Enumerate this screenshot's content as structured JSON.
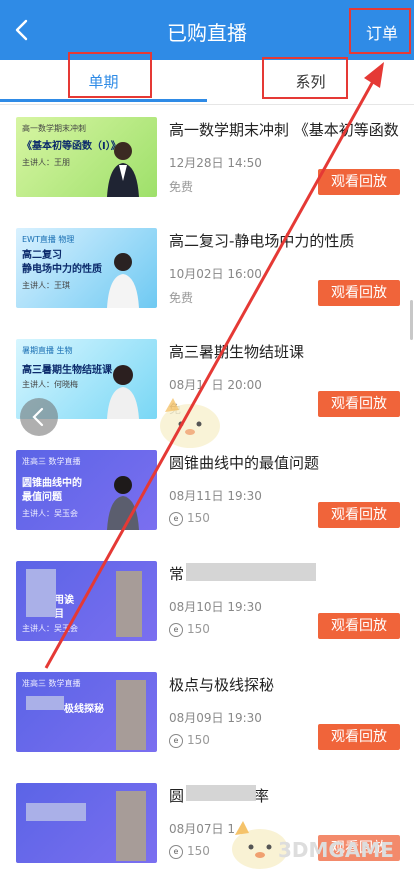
{
  "header": {
    "title": "已购直播",
    "order_label": "订单"
  },
  "tabs": [
    {
      "label": "单期",
      "active": true
    },
    {
      "label": "系列",
      "active": false
    }
  ],
  "items": [
    {
      "title": "高一数学期末冲刺 《基本初等函数",
      "time": "12月28日 14:50",
      "price": "免费",
      "action": "观看回放",
      "thumb": {
        "line1": "高一数学期末冲刺",
        "line2": "《基本初等函数（Ⅰ）》",
        "line3": "主讲人：王朋"
      }
    },
    {
      "title": "高二复习-静电场中力的性质",
      "time": "10月02日 16:00",
      "price": "免费",
      "action": "观看回放",
      "thumb": {
        "line1": "EWT直播  物理",
        "line2": "高二复习",
        "line3": "静电场中力的性质",
        "line4": "主讲人：王琪"
      }
    },
    {
      "title": "高三暑期生物结班课",
      "time": "08月1",
      "time_b": "日 20:00",
      "price": "免",
      "price_b": "费",
      "action": "观看回放",
      "thumb": {
        "line1": "暑期直播  生物",
        "line2": "高三暑期生物结班课",
        "line3": "主讲人：何晓梅"
      }
    },
    {
      "title": "圆锥曲线中的最值问题",
      "time": "08月11日 19:30",
      "price": "150",
      "action": "观看回放",
      "thumb": {
        "line1": "准高三  数学直播",
        "line2": "圆锥曲线中的",
        "line3": "最值问题",
        "line4": "主讲人：吴玉会"
      }
    },
    {
      "title": "常",
      "time": "08月10日 19:30",
      "price": "150",
      "action": "观看回放",
      "thumb": {
        "line1": "用诶",
        "line2": "目",
        "line3": "主讲人：吴玉会"
      }
    },
    {
      "title": "极点与极线探秘",
      "time": "08月09日 19:30",
      "price": "150",
      "action": "观看回放",
      "thumb": {
        "line1": "准高三  数学直播",
        "line2": "极线探秘"
      }
    },
    {
      "title": "圆",
      "title_b": "率",
      "time": "08月07日 1",
      "price": "150",
      "action": "观看回放",
      "thumb": {
        "line1": "",
        "line2": ""
      }
    }
  ],
  "watermark": "3DMGAME",
  "colors": {
    "header": "#2f8be6",
    "action": "#f0643a",
    "annotation": "#e53935"
  }
}
